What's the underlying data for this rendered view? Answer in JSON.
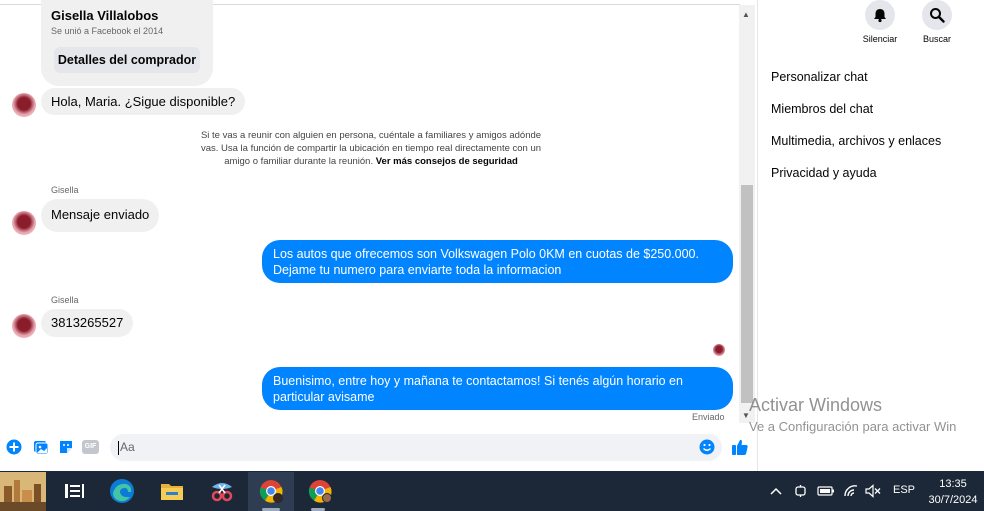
{
  "chat": {
    "profile": {
      "name": "Gisella Villalobos",
      "subtitle": "Se unió a Facebook el 2014",
      "buyer_button": "Detalles del comprador"
    },
    "messages": [
      {
        "text": "Hola, Maria. ¿Sigue disponible?"
      },
      {
        "sender": "Gisella",
        "text": "Mensaje enviado"
      },
      {
        "text": "Los autos que ofrecemos son Volkswagen Polo 0KM en cuotas de $250.000.  Dejame tu numero para enviarte toda la informacion"
      },
      {
        "sender": "Gisella",
        "text": "3813265527"
      },
      {
        "text": "Buenisimo, entre hoy y mañana te contactamos! Si tenés algún horario en particular avisame"
      }
    ],
    "safety_notice": {
      "text": "Si te vas a reunir con alguien en persona, cuéntale a familiares y amigos adónde vas. Usa la función de compartir la ubicación en tiempo real directamente con un amigo o familiar durante la reunión.",
      "link": "Ver más consejos de seguridad"
    },
    "sent_status": "Enviado",
    "composer": {
      "placeholder": "Aa",
      "gif_label": "GIF"
    }
  },
  "panel": {
    "actions": [
      {
        "label": "Silenciar",
        "icon": "bell-icon"
      },
      {
        "label": "Buscar",
        "icon": "search-icon"
      }
    ],
    "menu": [
      "Personalizar chat",
      "Miembros del chat",
      "Multimedia, archivos y enlaces",
      "Privacidad y ayuda"
    ]
  },
  "watermark": {
    "title": "Activar Windows",
    "subtitle": "Ve a Configuración para activar Win"
  },
  "taskbar": {
    "language": "ESP",
    "time": "13:35",
    "date": "30/7/2024"
  },
  "colors": {
    "messenger_blue": "#0084ff",
    "bubble_grey": "#f0f0f0",
    "taskbar": "#1c2838"
  }
}
